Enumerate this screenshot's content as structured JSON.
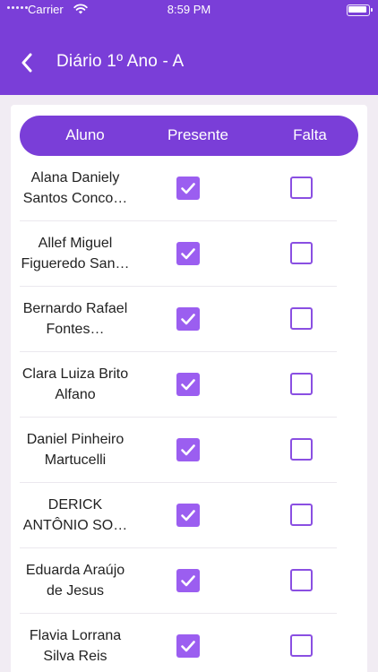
{
  "status": {
    "carrier": "Carrier",
    "time": "8:59 PM"
  },
  "header": {
    "title": "Diário 1º Ano - A",
    "back_icon": "chevron-left-icon"
  },
  "table": {
    "columns": [
      "Aluno",
      "Presente",
      "Falta"
    ],
    "rows": [
      {
        "name": "Alana Daniely Santos Conco…",
        "presente": true,
        "falta": false
      },
      {
        "name": "Allef Miguel Figueredo San…",
        "presente": true,
        "falta": false
      },
      {
        "name": "Bernardo Rafael Fontes…",
        "presente": true,
        "falta": false
      },
      {
        "name": "Clara Luiza Brito Alfano",
        "presente": true,
        "falta": false
      },
      {
        "name": "Daniel Pinheiro Martucelli",
        "presente": true,
        "falta": false
      },
      {
        "name": "DERICK ANTÔNIO SO…",
        "presente": true,
        "falta": false
      },
      {
        "name": "Eduarda Araújo de Jesus",
        "presente": true,
        "falta": false
      },
      {
        "name": "Flavia Lorrana Silva Reis",
        "presente": true,
        "falta": false
      }
    ]
  },
  "colors": {
    "primary": "#7a3ed8",
    "checkbox": "#9b5ef0",
    "background": "#f1ecf3"
  }
}
